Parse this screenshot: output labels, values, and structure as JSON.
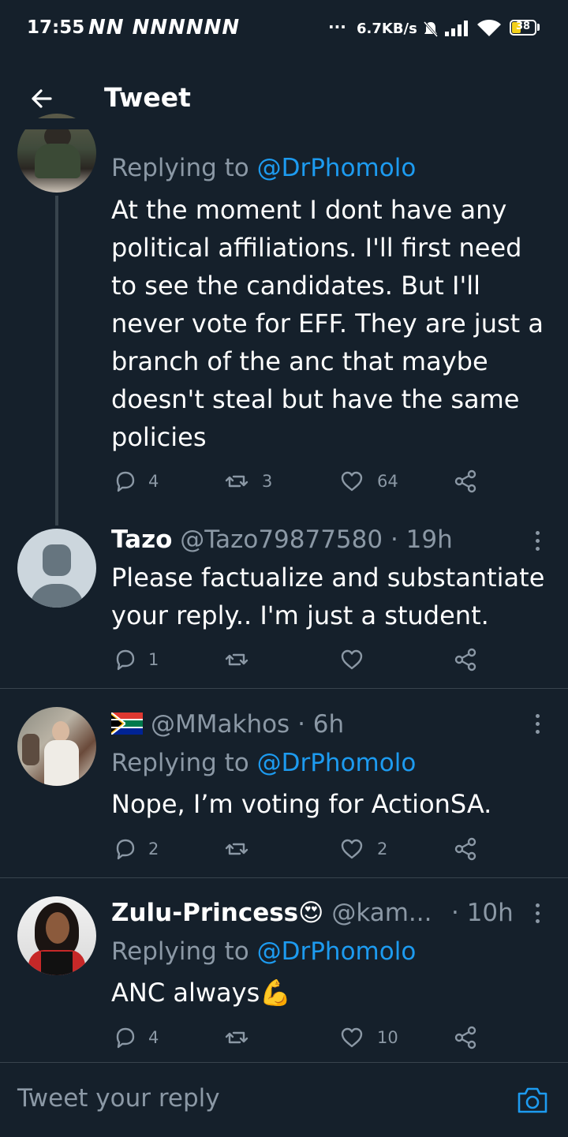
{
  "status_bar": {
    "time": "17:55",
    "carrier_icons": "NN  NNNNNN",
    "dots": "···",
    "speed": "6.7KB/s",
    "battery": "38"
  },
  "header": {
    "title": "Tweet"
  },
  "tweets": [
    {
      "replying_prefix": "Replying to ",
      "replying_handle": "@DrPhomolo",
      "lines": [
        "At the moment I dont have any",
        "political affiliations. I'll first need",
        "to see the candidates. But I'll",
        "never vote for EFF. They are just a",
        "branch of the anc that maybe",
        "doesn't steal but have the same",
        "policies"
      ],
      "replies": "4",
      "retweets": "3",
      "likes": "64"
    },
    {
      "name": "Tazo",
      "handle": "@Tazo79877580",
      "time": "· 19h",
      "lines": [
        "Please factualize and substantiate",
        "your reply.. I'm just a student."
      ],
      "replies": "1",
      "retweets": "",
      "likes": ""
    },
    {
      "handle": "@MMakhos",
      "time": "· 6h",
      "replying_prefix": "Replying to ",
      "replying_handle": "@DrPhomolo",
      "lines": [
        "Nope, I’m voting for ActionSA."
      ],
      "replies": "2",
      "retweets": "",
      "likes": "2"
    },
    {
      "name": "Zulu-Princess",
      "name_emoji": "😍",
      "handle": "@kam...",
      "time": "· 10h",
      "replying_prefix": "Replying to ",
      "replying_handle": "@DrPhomolo",
      "text": "ANC always",
      "text_emoji": "💪",
      "replies": "4",
      "retweets": "",
      "likes": "10"
    }
  ],
  "composer": {
    "placeholder": "Tweet your reply"
  },
  "colors": {
    "background": "#15202b",
    "accent": "#1d9bf0",
    "muted": "#8b98a5",
    "divider": "#38444d"
  }
}
